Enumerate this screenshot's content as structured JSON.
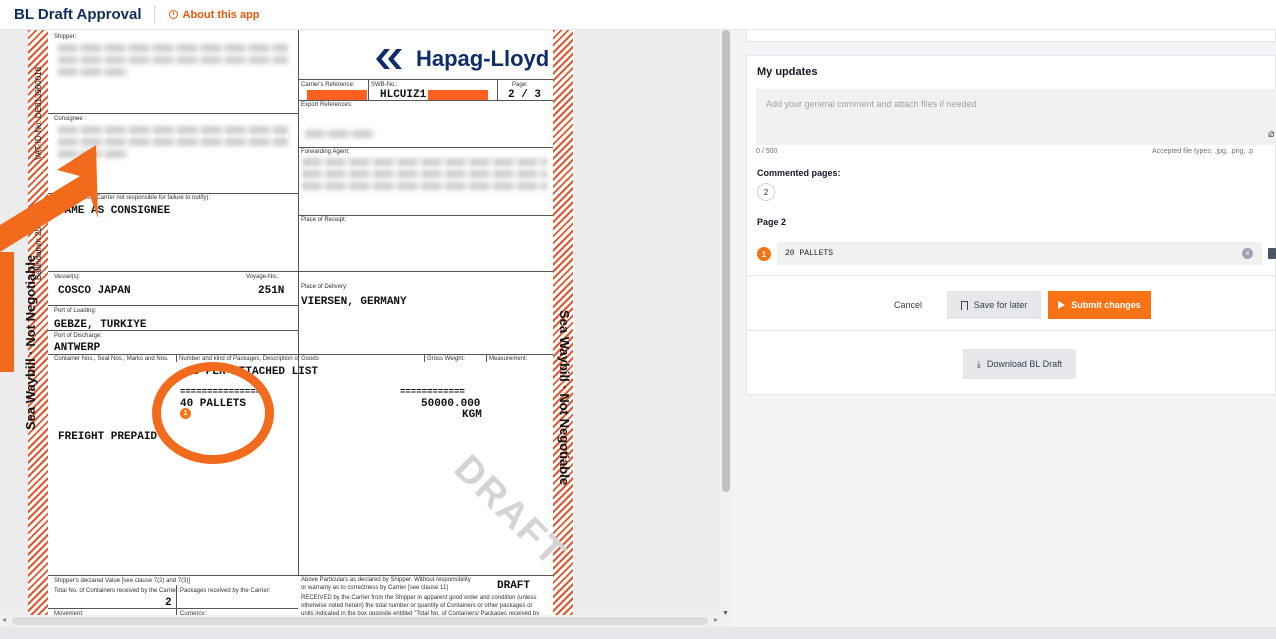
{
  "app": {
    "title": "BL Draft Approval",
    "about_label": "About this app"
  },
  "document": {
    "labels": {
      "shipper": "Shipper:",
      "consignee": "Consignee :",
      "notify": "Notify Address (Carrier not responsible for failure to notify):",
      "carriers_ref": "Carrier's Reference:",
      "swb_no": "SWB-No.:",
      "page": "Page:",
      "export_refs": "Export References:",
      "forwarding_agent": "Forwarding Agent:",
      "place_of_receipt": "Place of Receipt:",
      "vessels": "Vessel(s):",
      "voyage_no": "Voyage-No.:",
      "place_of_delivery": "Place of Delivery:",
      "port_of_loading": "Port of Loading:",
      "port_of_discharge": "Port of Discharge:",
      "container_nos": "Container Nos., Seal Nos.; Marks and Nos.",
      "number_kind": "Number and kind of Packages, Description of Goods",
      "gross_weight": "Gross Weight:",
      "measurement": "Measurement:",
      "declared_value": "Shipper's declared Value [see clause 7(2) and 7(3)]",
      "total_containers": "Total No. of Containers received by the Carrier:",
      "packages_received": "Packages received by the Carrier:",
      "movement": "Movement:",
      "currency": "Currency:",
      "above_particulars": "Above Particulars as declared by Shipper. Without responsibility",
      "warranty": "or warranty as to correctness by Carrier [see clause 11]",
      "received_1": "RECEIVED by the Carrier from the Shipper in apparent good order and condition (unless",
      "received_2": "otherwise noted herein) the total number or quantity of Containers or other packages or",
      "received_3": "units indicated in the box opposite entitled \"Total No. of Containers/ Packages received by"
    },
    "logo_text": "Hapag-Lloyd",
    "swb_number": "HLCUIZ1",
    "page_value": "2 / 3",
    "notify_value": "SAME AS CONSIGNEE",
    "vessel": "COSCO JAPAN",
    "voyage": "251N",
    "place_of_delivery_value": "VIERSEN, GERMANY",
    "port_of_loading_value": "GEBZE, TURKIYE",
    "port_of_discharge_value": "ANTWERP",
    "description_1": "AS PER ATTACHED LIST",
    "dashes_1": "===============",
    "pallets": "40 PALLETS",
    "dashes_2": "============",
    "weight": "50000.000",
    "weight_unit": "KGM",
    "freight": "FREIGHT PREPAID",
    "total_containers_value": "2",
    "draft_label": "DRAFT",
    "watermark": "DRAFT",
    "side_text": "Sea Waybill · Not Negotiable",
    "side_small": "VAT-ID-No: DE813960018",
    "side_small_2": "Ballindamm 25 · D",
    "annotation_badge": "1"
  },
  "panel": {
    "my_updates_title": "My updates",
    "comment_placeholder": "Add your general comment and attach files if needed",
    "char_counter": "0 / 500",
    "accepted_types": "Accepted file types: .jpg, .png, .p",
    "commented_pages_label": "Commented pages:",
    "commented_pages": [
      "2"
    ],
    "page_heading": "Page 2",
    "update_badge": "1",
    "update_value": "20 PALLETS",
    "cancel_label": "Cancel",
    "save_label": "Save for later",
    "submit_label": "Submit changes",
    "download_label": "Download BL Draft"
  },
  "colors": {
    "accent": "#f97316",
    "brand_navy": "#0f2d6b",
    "annotation_orange": "#f26a1b"
  }
}
